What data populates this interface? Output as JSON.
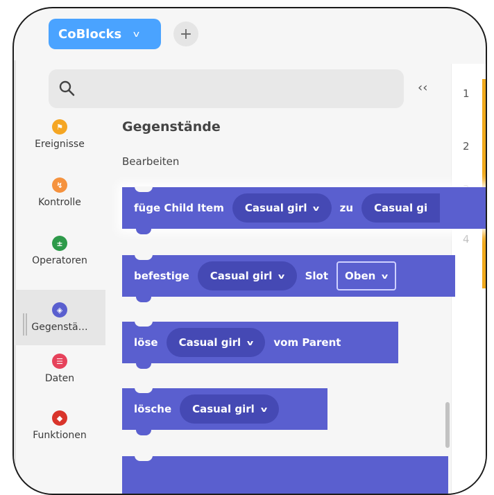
{
  "header": {
    "project_label": "CoBlocks",
    "add_label": "+"
  },
  "search": {
    "placeholder": "",
    "collapse_label": "‹‹"
  },
  "line_numbers": [
    "1",
    "2",
    "3",
    "4"
  ],
  "categories": [
    {
      "label": "Ereignisse",
      "color": "#f5a623",
      "icon": "flag-icon"
    },
    {
      "label": "Kontrolle",
      "color": "#f5923e",
      "icon": "control-icon"
    },
    {
      "label": "Operatoren",
      "color": "#2e9a4a",
      "icon": "operators-icon"
    },
    {
      "label": "Gegenstä…",
      "color": "#5a5fcf",
      "icon": "cube-icon",
      "active": true
    },
    {
      "label": "Daten",
      "color": "#e6425b",
      "icon": "data-icon"
    },
    {
      "label": "Funktionen",
      "color": "#d9342b",
      "icon": "functions-icon"
    }
  ],
  "section": {
    "title": "Gegenstände",
    "subtitle": "Bearbeiten"
  },
  "blocks": {
    "b1": {
      "prefix": "füge Child Item",
      "dropdown1": "Casual girl",
      "mid": "zu",
      "dropdown2": "Casual gi"
    },
    "b2": {
      "prefix": "befestige",
      "dropdown1": "Casual girl",
      "mid": "Slot",
      "select": "Oben"
    },
    "b3": {
      "prefix": "löse",
      "dropdown1": "Casual girl",
      "suffix": "vom Parent"
    },
    "b4": {
      "prefix": "lösche",
      "dropdown1": "Casual girl"
    }
  },
  "colors": {
    "block": "#5a5fcf",
    "pill": "#4549b4",
    "accent": "#4aa3ff",
    "line_marker": "#f0a91c"
  }
}
